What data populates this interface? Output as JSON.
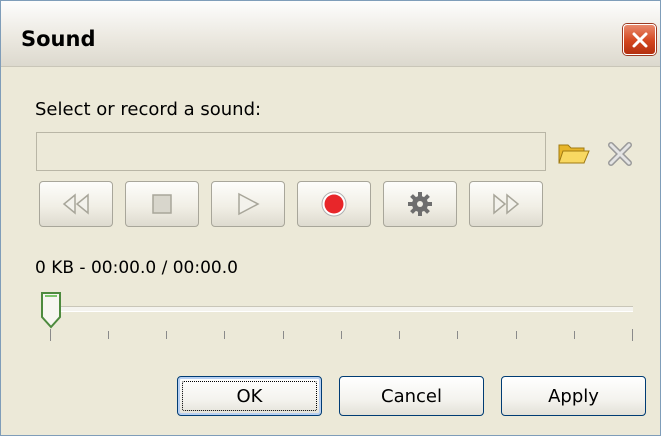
{
  "window": {
    "title": "Sound"
  },
  "section": {
    "prompt": "Select or record a sound:"
  },
  "file": {
    "value": ""
  },
  "transport": {
    "buttons": [
      {
        "name": "rewind",
        "icon": "rewind-icon"
      },
      {
        "name": "stop",
        "icon": "stop-icon"
      },
      {
        "name": "play",
        "icon": "play-icon"
      },
      {
        "name": "record",
        "icon": "record-icon"
      },
      {
        "name": "settings",
        "icon": "gear-icon"
      },
      {
        "name": "fast-forward",
        "icon": "fast-forward-icon"
      }
    ]
  },
  "status": {
    "text": "0 KB - 00:00.0 / 00:00.0"
  },
  "slider": {
    "position": 0
  },
  "buttons": {
    "ok": "OK",
    "cancel": "Cancel",
    "apply": "Apply"
  },
  "colors": {
    "record": "#e8262a",
    "folder": "#f2c93a",
    "close": "#d3461f"
  }
}
